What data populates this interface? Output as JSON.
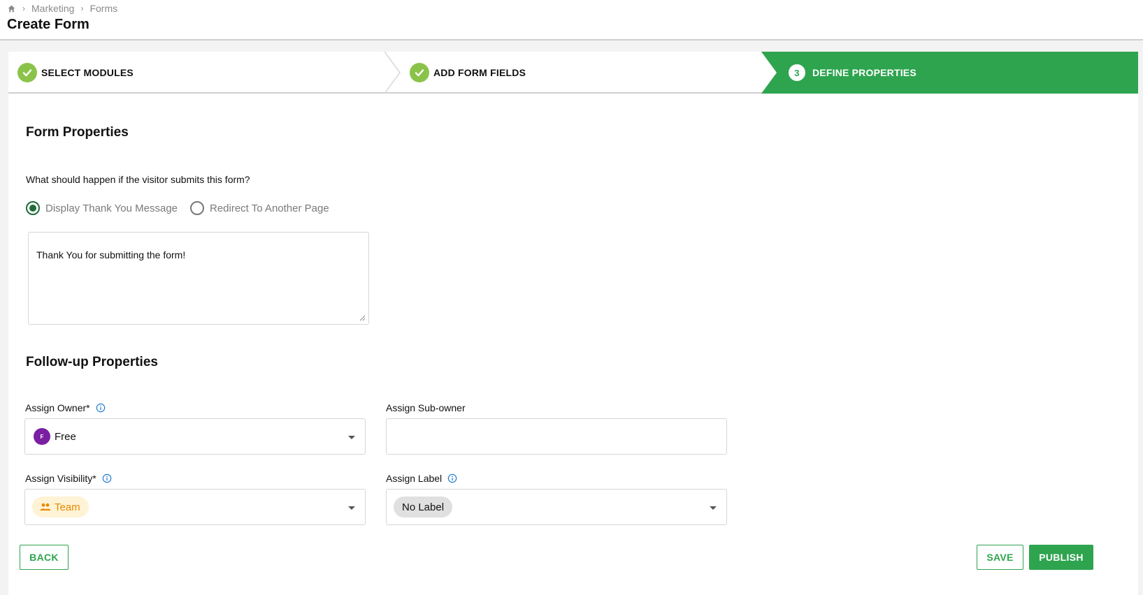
{
  "breadcrumb": {
    "items": [
      "Marketing",
      "Forms"
    ]
  },
  "page": {
    "title": "Create Form"
  },
  "stepper": {
    "steps": [
      {
        "label": "SELECT MODULES",
        "status": "complete"
      },
      {
        "label": "ADD FORM FIELDS",
        "status": "complete"
      },
      {
        "label": "DEFINE PROPERTIES",
        "number": "3",
        "status": "active"
      }
    ]
  },
  "form_properties": {
    "title": "Form Properties",
    "question": "What should happen if the visitor submits this form?",
    "options": [
      {
        "label": "Display Thank You Message",
        "selected": true
      },
      {
        "label": "Redirect To Another Page",
        "selected": false
      }
    ],
    "message": "Thank You for submitting the form!"
  },
  "followup": {
    "title": "Follow-up Properties",
    "owner": {
      "label": "Assign Owner*",
      "value": "Free",
      "avatar_initial": "F"
    },
    "subowner": {
      "label": "Assign Sub-owner",
      "value": ""
    },
    "visibility": {
      "label": "Assign Visibility*",
      "value": "Team"
    },
    "label_field": {
      "label": "Assign Label",
      "value": "No Label"
    }
  },
  "actions": {
    "back": "BACK",
    "save": "SAVE",
    "publish": "PUBLISH"
  },
  "colors": {
    "primary": "#2ea44f",
    "complete": "#8bc34a",
    "avatar": "#7b1fa2",
    "team_chip_text": "#e88a00"
  },
  "icons": {
    "home": "home-icon",
    "breadcrumb_separator": "chevron-right-icon",
    "step_complete": "check-icon",
    "info": "info-icon",
    "dropdown": "caret-down-icon",
    "team": "people-icon"
  }
}
